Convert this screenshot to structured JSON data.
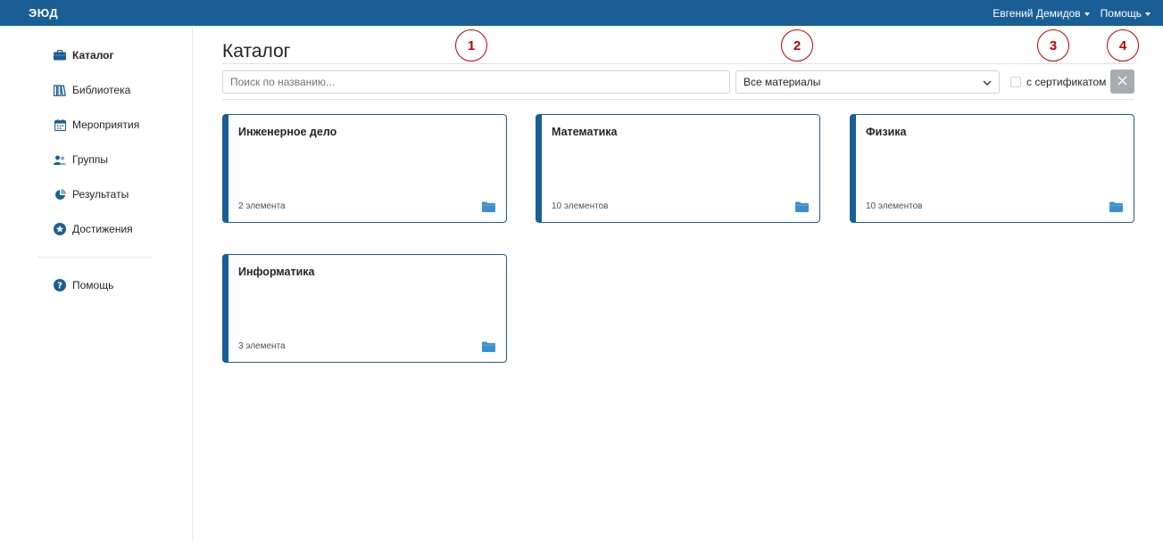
{
  "app": {
    "logo": "ЭЮД"
  },
  "topnav": {
    "user": "Евгений Демидов",
    "help": "Помощь"
  },
  "sidebar": {
    "items": [
      {
        "label": "Каталог",
        "icon": "briefcase-icon"
      },
      {
        "label": "Библиотека",
        "icon": "books-icon"
      },
      {
        "label": "Мероприятия",
        "icon": "calendar-icon"
      },
      {
        "label": "Группы",
        "icon": "users-icon"
      },
      {
        "label": "Результаты",
        "icon": "pie-chart-icon"
      },
      {
        "label": "Достижения",
        "icon": "star-badge-icon"
      }
    ],
    "help": {
      "label": "Помощь",
      "icon": "question-circle-icon"
    }
  },
  "main": {
    "title": "Каталог",
    "filters": {
      "search_placeholder": "Поиск по названию...",
      "search_value": "",
      "select_value": "Все материалы",
      "cert_label": "с сертификатом",
      "cert_checked": false
    },
    "cards": [
      {
        "title": "Инженерное дело",
        "count": "2 элемента"
      },
      {
        "title": "Математика",
        "count": "10 элементов"
      },
      {
        "title": "Физика",
        "count": "10 элементов"
      },
      {
        "title": "Информатика",
        "count": "3 элемента"
      }
    ]
  },
  "annotations": [
    "1",
    "2",
    "3",
    "4"
  ],
  "colors": {
    "brand": "#1a5e96",
    "folder": "#3a8fd0",
    "marker": "#c00000"
  }
}
